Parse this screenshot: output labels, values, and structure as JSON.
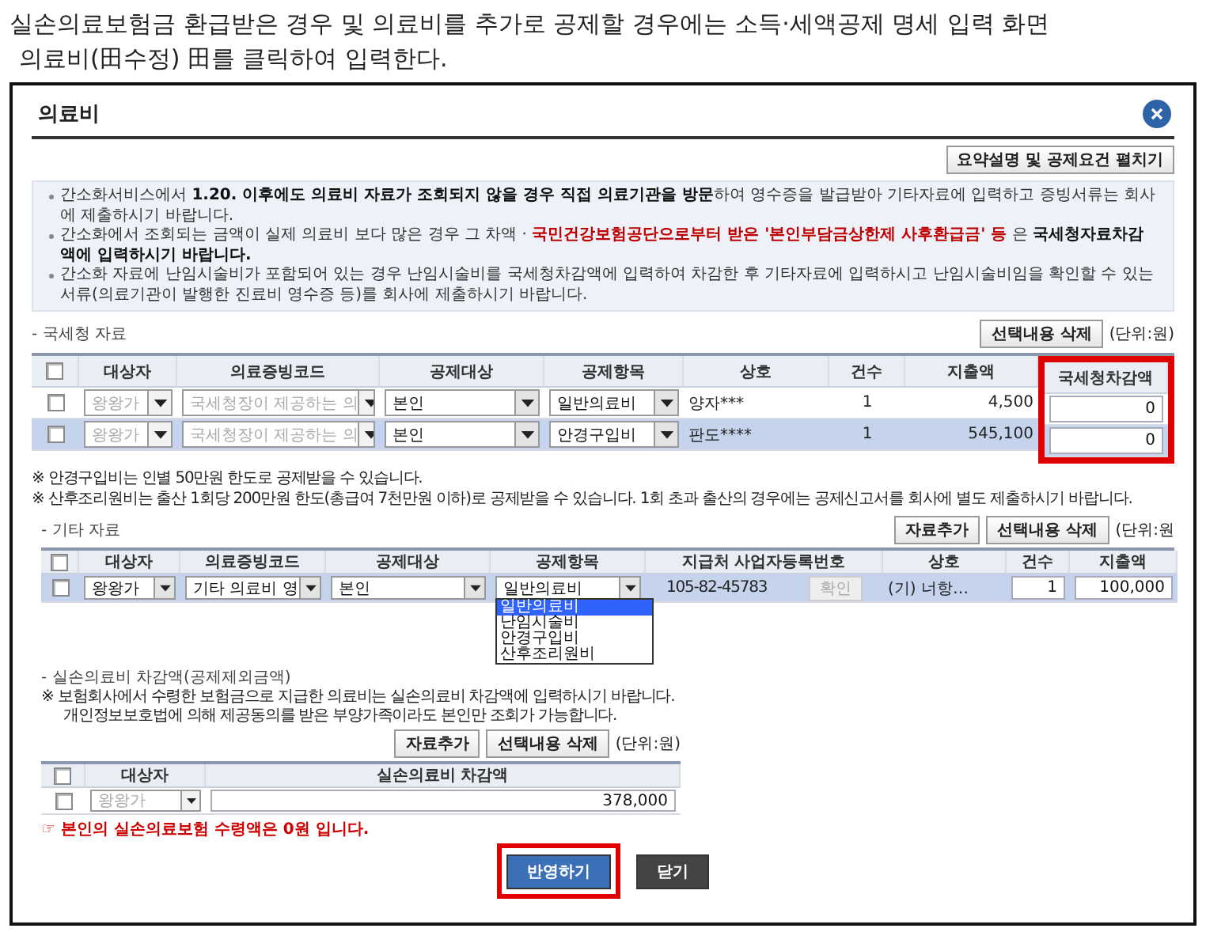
{
  "instructions": [
    "실손의료보험금 환급받은 경우 및 의료비를 추가로 공제할 경우에는 소득·세액공제 명세 입력 화면",
    "의료비(田수정) 田를 클릭하여 입력한다."
  ],
  "dialog": {
    "title": "의료비",
    "summary_button": "요약설명 및 공제요건 펼치기",
    "notices": [
      [
        {
          "kind": "plain",
          "text": "간소화서비스에서 "
        },
        {
          "kind": "strong",
          "text": "1.20. 이후에도 의료비 자료가 조회되지 않을 경우 직접 의료기관을 방문"
        },
        {
          "kind": "plain",
          "text": "하여 영수증을 발급받아 기타자료에 입력하고 증빙서류는 회사에 제출하시기 바랍니다."
        }
      ],
      [
        {
          "kind": "plain",
          "text": "간소화에서 조회되는 금액이 실제 의료비 보다 많은 경우 그 차액 · "
        },
        {
          "kind": "alert",
          "text": "국민건강보험공단으로부터 받은 '본인부담금상한제 사후환급금' 등"
        },
        {
          "kind": "plain",
          "text": " 은 "
        },
        {
          "kind": "strong",
          "text": "국세청자료차감액에 입력하시기 바랍니다."
        }
      ],
      [
        {
          "kind": "plain",
          "text": "간소화 자료에 난임시술비가 포함되어 있는 경우 난임시술비를 국세청차감액에 입력하여 차감한 후 기타자료에 입력하시고 난임시술비임을 확인할 수 있는 서류(의료기관이 발행한 진료비 영수증 등)를 회사에 제출하시기 바랍니다."
        }
      ]
    ],
    "nts": {
      "label": "- 국세청 자료",
      "buttons": [
        "선택내용 삭제"
      ],
      "unit": "(단위:원)",
      "columns": [
        {
          "kind": "checkbox",
          "checked": false
        },
        {
          "kind": "text",
          "label": "대상자"
        },
        {
          "kind": "text",
          "label": "의료증빙코드"
        },
        {
          "kind": "text",
          "label": "공제대상"
        },
        {
          "kind": "text",
          "label": "공제항목"
        },
        {
          "kind": "text",
          "label": "상호"
        },
        {
          "kind": "text",
          "label": "건수"
        },
        {
          "kind": "text",
          "label": "지출액"
        },
        {
          "kind": "text",
          "label": "국세청차감액",
          "callout": true
        }
      ],
      "rows": [
        {
          "selected": false,
          "cells": [
            {
              "kind": "checkbox",
              "checked": false
            },
            {
              "kind": "select",
              "value": "왕왕가",
              "disabled": true
            },
            {
              "kind": "select",
              "value": "국세청장이 제공하는 의",
              "disabled": true
            },
            {
              "kind": "select",
              "value": "본인",
              "disabled": false
            },
            {
              "kind": "select",
              "value": "일반의료비",
              "disabled": false
            },
            {
              "kind": "name",
              "value": "양자***"
            },
            {
              "kind": "count",
              "value": "1"
            },
            {
              "kind": "amount",
              "value": "4,500"
            },
            {
              "kind": "input",
              "value": "0"
            }
          ]
        },
        {
          "selected": true,
          "cells": [
            {
              "kind": "checkbox",
              "checked": false
            },
            {
              "kind": "select",
              "value": "왕왕가",
              "disabled": true
            },
            {
              "kind": "select",
              "value": "국세청장이 제공하는 의",
              "disabled": true
            },
            {
              "kind": "select",
              "value": "본인",
              "disabled": false
            },
            {
              "kind": "select",
              "value": "안경구입비",
              "disabled": false
            },
            {
              "kind": "name",
              "value": "판도****"
            },
            {
              "kind": "count",
              "value": "1"
            },
            {
              "kind": "amount",
              "value": "545,100"
            },
            {
              "kind": "input",
              "value": "0"
            }
          ]
        }
      ]
    },
    "nts_notes": [
      "※ 안경구입비는 인별 50만원 한도로 공제받을 수 있습니다.",
      "※ 산후조리원비는 출산 1회당 200만원 한도(총급여 7천만원 이하)로 공제받을 수 있습니다. 1회 초과 출산의 경우에는 공제신고서를 회사에 별도 제출하시기 바랍니다."
    ],
    "other": {
      "label": "- 기타 자료",
      "buttons": [
        "자료추가",
        "선택내용 삭제"
      ],
      "unit": "(단위:원",
      "columns": [
        {
          "kind": "checkbox",
          "checked": false
        },
        {
          "kind": "text",
          "label": "대상자"
        },
        {
          "kind": "text",
          "label": "의료증빙코드"
        },
        {
          "kind": "text",
          "label": "공제대상"
        },
        {
          "kind": "text",
          "label": "공제항목"
        },
        {
          "kind": "text",
          "label": "지급처 사업자등록번호"
        },
        {
          "kind": "text",
          "label": "상호"
        },
        {
          "kind": "text",
          "label": "건수"
        },
        {
          "kind": "text",
          "label": "지출액"
        }
      ],
      "rows": [
        {
          "selected": true,
          "cells": [
            {
              "kind": "checkbox",
              "checked": false
            },
            {
              "kind": "select",
              "value": "왕왕가",
              "disabled": false
            },
            {
              "kind": "select",
              "value": "기타 의료비 영",
              "disabled": false
            },
            {
              "kind": "select",
              "value": "본인",
              "disabled": false
            },
            {
              "kind": "select",
              "value": "일반의료비",
              "disabled": false,
              "open": true,
              "options": [
                {
                  "label": "일반의료비",
                  "selected": true
                },
                {
                  "label": "난임시술비",
                  "selected": false
                },
                {
                  "label": "안경구입비",
                  "selected": false
                },
                {
                  "label": "산후조리원비",
                  "selected": false
                }
              ]
            },
            {
              "kind": "lookup",
              "value": "105-82-45783",
              "button": "확인",
              "button_disabled": true
            },
            {
              "kind": "name",
              "value": "(기) 너항…"
            },
            {
              "kind": "input",
              "value": "1"
            },
            {
              "kind": "input",
              "value": "100,000"
            }
          ]
        }
      ]
    },
    "insurance_label": "- 실손의료비 차감액(공제제외금액)",
    "insurance_notes": [
      "※ 보험회사에서 수령한 보험금으로 지급한 의료비는 실손의료비 차감액에 입력하시기 바랍니다.",
      "개인정보보호법에 의해 제공동의를 받은 부양가족이라도 본인만 조회가 가능합니다."
    ],
    "insurance": {
      "buttons": [
        "자료추가",
        "선택내용 삭제"
      ],
      "unit": "(단위:원)",
      "columns": [
        {
          "kind": "checkbox",
          "checked": false
        },
        {
          "kind": "text",
          "label": "대상자"
        },
        {
          "kind": "text",
          "label": "실손의료비 차감액"
        }
      ],
      "rows": [
        {
          "selected": false,
          "cells": [
            {
              "kind": "checkbox",
              "checked": false
            },
            {
              "kind": "select",
              "value": "왕왕가",
              "disabled": true
            },
            {
              "kind": "input",
              "value": "378,000"
            }
          ]
        }
      ]
    },
    "warning": "☞ 본인의 실손의료보험 수령액은 0원 입니다.",
    "actions": [
      {
        "kind": "primary",
        "label": "반영하기",
        "callout": true
      },
      {
        "kind": "dark",
        "label": "닫기"
      }
    ]
  }
}
